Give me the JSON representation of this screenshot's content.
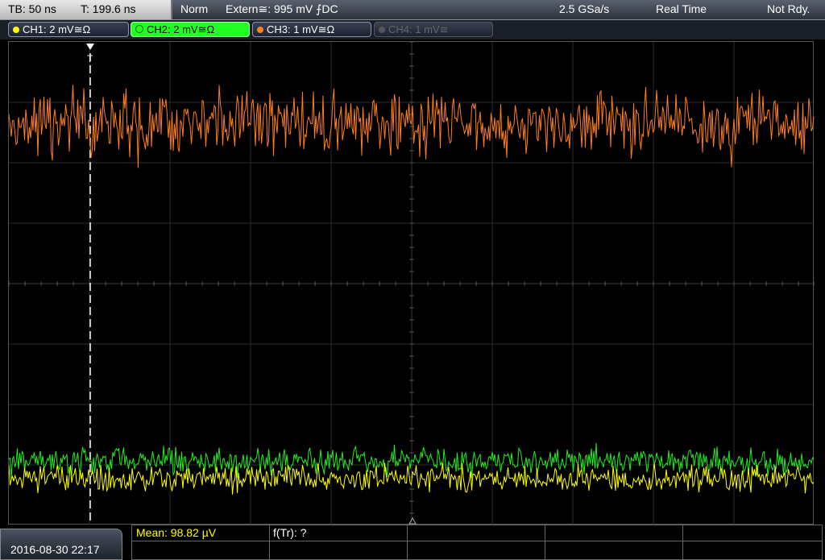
{
  "top": {
    "timebase": "TB: 50 ns",
    "trigger_time": "T: 199.6 ns",
    "mode": "Norm",
    "trigger_source": "Extern≅: 995 mV ⨍DC",
    "sample_rate": "2.5 GSa/s",
    "acq_mode": "Real Time",
    "status": "Not Rdy."
  },
  "channels": [
    {
      "label": "CH1: 2 mV≅Ω",
      "color": "#ffff00",
      "state": "on"
    },
    {
      "label": "CH2: 2 mV≅Ω",
      "color": "#00ff00",
      "state": "selected"
    },
    {
      "label": "CH3: 1 mV≅Ω",
      "color": "#ff7f1e",
      "state": "on"
    },
    {
      "label": "CH4: 1 mV≅",
      "color": "#555555",
      "state": "off"
    }
  ],
  "traces": {
    "ch3_color": "#ff7f1e",
    "ch2_color": "#22ee22",
    "ch1_color": "#ffff00"
  },
  "bottom": {
    "datetime": "2016-08-30 22:17",
    "mean_label": "Mean: 98.82 µV",
    "freq_label": "f(Tr): ?"
  }
}
